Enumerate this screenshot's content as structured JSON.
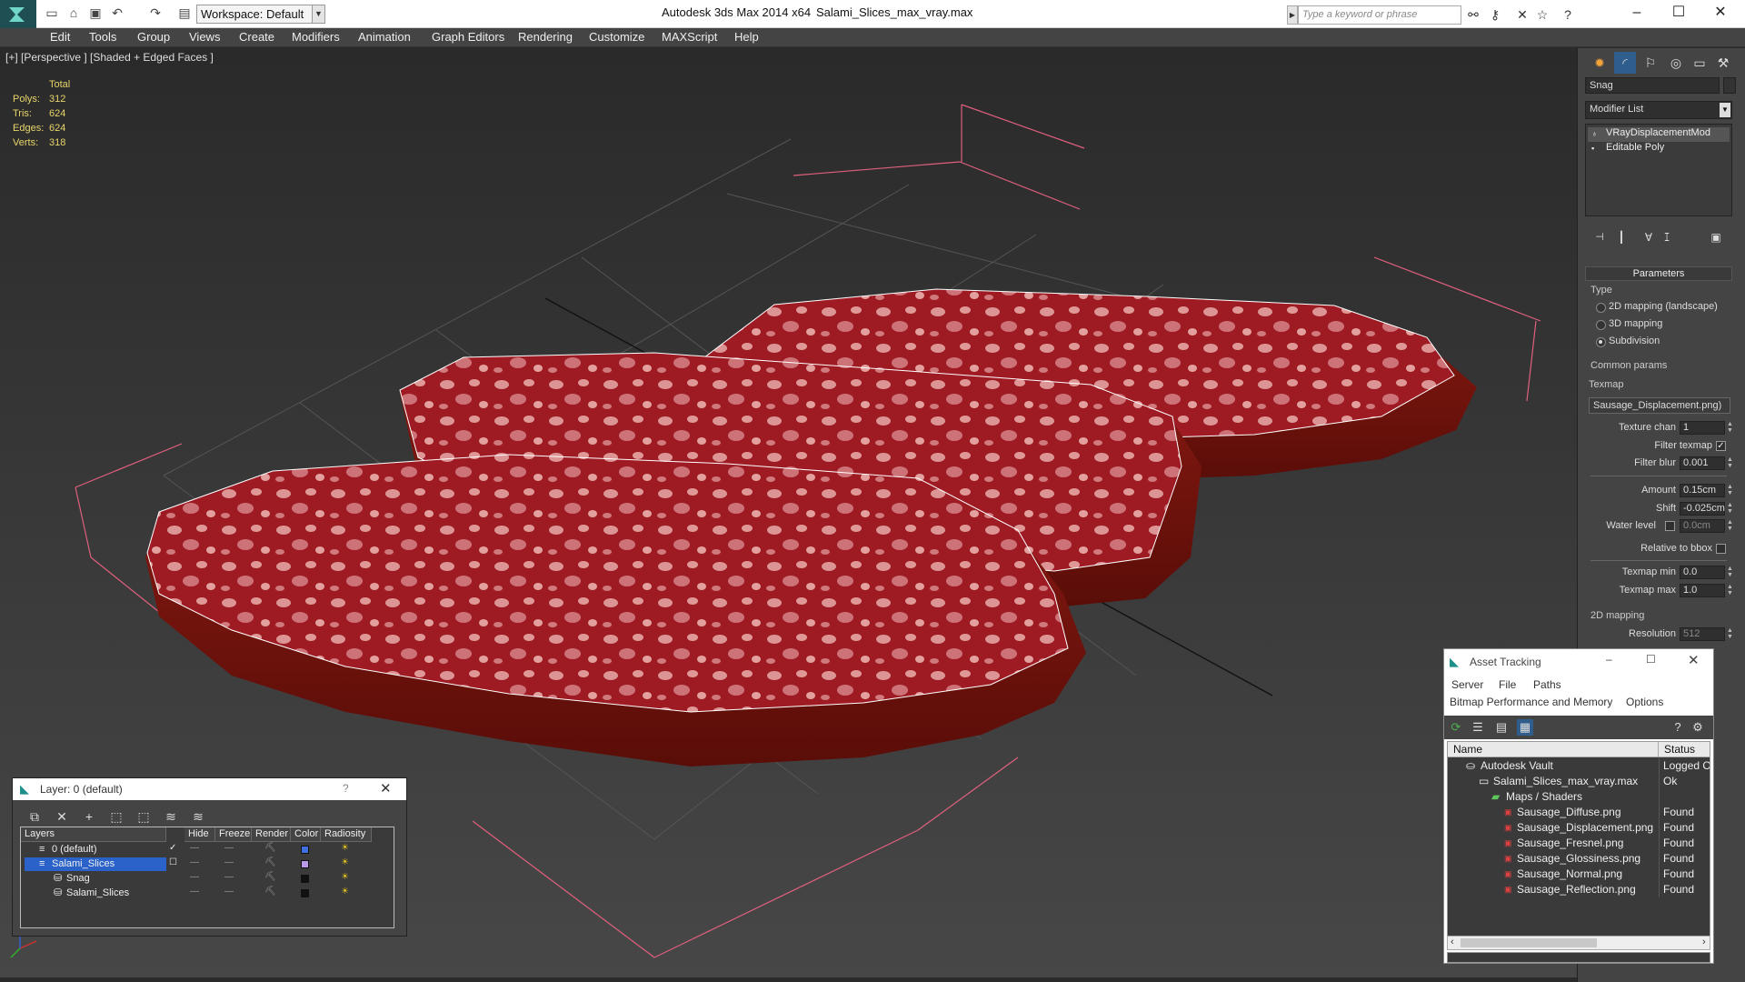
{
  "title": {
    "app": "Autodesk 3ds Max  2014 x64",
    "file": "Salami_Slices_max_vray.max"
  },
  "toolbar": {
    "workspace": "Workspace: Default",
    "search_placeholder": "Type a keyword or phrase"
  },
  "menu": [
    "Edit",
    "Tools",
    "Group",
    "Views",
    "Create",
    "Modifiers",
    "Animation",
    "Graph Editors",
    "Rendering",
    "Customize",
    "MAXScript",
    "Help"
  ],
  "viewport": {
    "label": "[+] [Perspective ] [Shaded + Edged Faces ]",
    "stats": {
      "header": "Total",
      "rows": [
        {
          "label": "Polys:",
          "value": "312"
        },
        {
          "label": "Tris:",
          "value": "624"
        },
        {
          "label": "Edges:",
          "value": "624"
        },
        {
          "label": "Verts:",
          "value": "318"
        }
      ]
    }
  },
  "cmdpanel": {
    "object_name": "Snag",
    "modifier_list": "Modifier List",
    "stack": [
      "VRayDisplacementMod",
      "Editable Poly"
    ],
    "params_title": "Parameters",
    "type_title": "Type",
    "types": [
      "2D mapping (landscape)",
      "3D mapping",
      "Subdivision"
    ],
    "common_title": "Common params",
    "texmap_label": "Texmap",
    "texmap_value": "Sausage_Displacement.png)",
    "texture_chan_label": "Texture chan",
    "texture_chan": "1",
    "filter_texmap_label": "Filter texmap",
    "filter_blur_label": "Filter blur",
    "filter_blur": "0.001",
    "amount_label": "Amount",
    "amount": "0.15cm",
    "shift_label": "Shift",
    "shift": "-0.025cm",
    "water_label": "Water level",
    "water": "0.0cm",
    "relbbox_label": "Relative to bbox",
    "texmin_label": "Texmap min",
    "texmin": "0.0",
    "texmax_label": "Texmap max",
    "texmax": "1.0",
    "map2d_title": "2D mapping",
    "resolution_label": "Resolution",
    "resolution": "512"
  },
  "layers": {
    "title": "Layer: 0 (default)",
    "help": "?",
    "columns": [
      "Layers",
      "Hide",
      "Freeze",
      "Render",
      "Color",
      "Radiosity"
    ],
    "rows": [
      {
        "name": "0 (default)",
        "color": "#3f6fe0"
      },
      {
        "name": "Salami_Slices",
        "color": "#b89ae8"
      },
      {
        "name": "Snag",
        "color": "#111111"
      },
      {
        "name": "Salami_Slices",
        "color": "#111111"
      }
    ]
  },
  "assets": {
    "title": "Asset Tracking",
    "menu": [
      "Server",
      "File",
      "Paths",
      "Bitmap Performance and Memory",
      "Options"
    ],
    "columns": [
      "Name",
      "Status"
    ],
    "rows": [
      {
        "name": "Autodesk Vault",
        "status": "Logged O"
      },
      {
        "name": "Salami_Slices_max_vray.max",
        "status": "Ok"
      },
      {
        "name": "Maps / Shaders",
        "status": ""
      },
      {
        "name": "Sausage_Diffuse.png",
        "status": "Found"
      },
      {
        "name": "Sausage_Displacement.png",
        "status": "Found"
      },
      {
        "name": "Sausage_Fresnel.png",
        "status": "Found"
      },
      {
        "name": "Sausage_Glossiness.png",
        "status": "Found"
      },
      {
        "name": "Sausage_Normal.png",
        "status": "Found"
      },
      {
        "name": "Sausage_Reflection.png",
        "status": "Found"
      }
    ]
  },
  "colors": {
    "accent": "#1f4f52",
    "stats": "#e8d66a",
    "salami": "#9e1b24",
    "selection": "#2a62c9"
  }
}
